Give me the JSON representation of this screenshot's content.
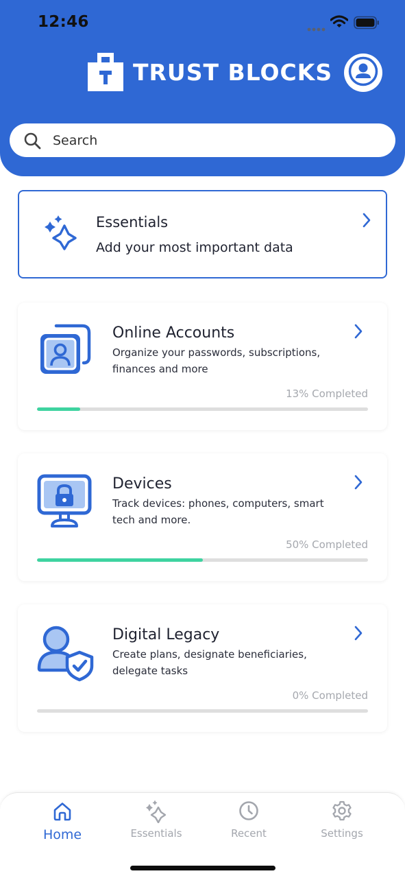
{
  "status_bar": {
    "time": "12:46"
  },
  "header": {
    "app_name": "TRUST BLOCKS",
    "brand_color": "#2f68d4"
  },
  "search": {
    "placeholder": "Search"
  },
  "essentials": {
    "title": "Essentials",
    "subtitle": "Add your most important data"
  },
  "cards": [
    {
      "title": "Online Accounts",
      "description": "Organize your passwords, subscriptions, finances and more",
      "progress_label": "13% Completed",
      "progress": 0.13,
      "icon": "accounts-icon"
    },
    {
      "title": "Devices",
      "description": "Track devices: phones, computers, smart tech and more.",
      "progress_label": "50% Completed",
      "progress": 0.5,
      "icon": "device-lock-icon"
    },
    {
      "title": "Digital Legacy",
      "description": "Create plans, designate beneficiaries, delegate tasks",
      "progress_label": "0% Completed",
      "progress": 0.0,
      "icon": "person-shield-icon"
    }
  ],
  "tabbar": {
    "items": [
      {
        "label": "Home",
        "icon": "home-icon",
        "active": true
      },
      {
        "label": "Essentials",
        "icon": "sparkle-icon",
        "active": false
      },
      {
        "label": "Recent",
        "icon": "clock-icon",
        "active": false
      },
      {
        "label": "Settings",
        "icon": "gear-icon",
        "active": false
      }
    ]
  },
  "colors": {
    "accent": "#2f68d4",
    "progress": "#3ed3a0",
    "track": "#dedede"
  }
}
